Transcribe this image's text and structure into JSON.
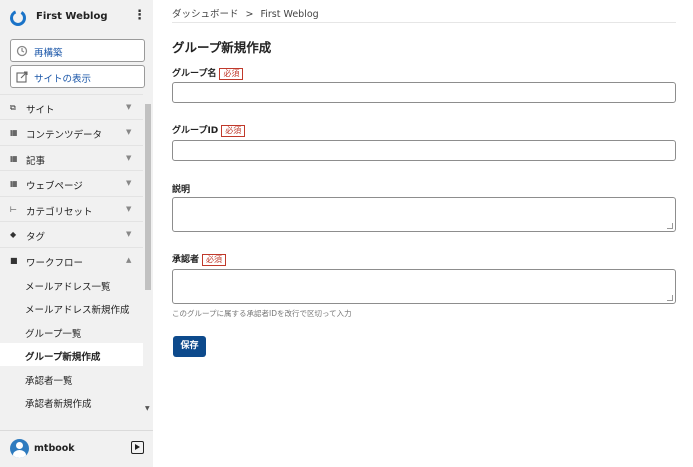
{
  "sidebar": {
    "site_title": "First Weblog",
    "kebab": "⋮",
    "buttons": [
      {
        "label": "再構築",
        "icon": "rebuild-icon"
      },
      {
        "label": "サイトの表示",
        "icon": "external-view-icon"
      }
    ],
    "menu": [
      {
        "label": "サイト",
        "icon": "site-icon",
        "chevron": "▼"
      },
      {
        "label": "コンテンツデータ",
        "icon": "content-data-icon",
        "chevron": "▼"
      },
      {
        "label": "記事",
        "icon": "entry-icon",
        "chevron": "▼"
      },
      {
        "label": "ウェブページ",
        "icon": "webpage-icon",
        "chevron": "▼"
      },
      {
        "label": "カテゴリセット",
        "icon": "category-set-icon",
        "chevron": "▼"
      },
      {
        "label": "タグ",
        "icon": "tag-icon",
        "chevron": "▼"
      },
      {
        "label": "ワークフロー",
        "icon": "workflow-icon",
        "chevron": "▲"
      }
    ],
    "submenu": [
      {
        "label": "メールアドレス一覧"
      },
      {
        "label": "メールアドレス新規作成"
      },
      {
        "label": "グループ一覧"
      },
      {
        "label": "グループ新規作成",
        "active": true
      },
      {
        "label": "承認者一覧"
      },
      {
        "label": "承認者新規作成"
      }
    ],
    "user": {
      "name": "mtbook"
    }
  },
  "breadcrumb": {
    "home": "ダッシュボード",
    "separator": ">",
    "current": "First Weblog"
  },
  "page": {
    "title": "グループ新規作成"
  },
  "form": {
    "group_name": {
      "label": "グループ名",
      "required": "必須",
      "value": ""
    },
    "group_id": {
      "label": "グループID",
      "required": "必須",
      "value": ""
    },
    "description": {
      "label": "説明",
      "value": ""
    },
    "approver": {
      "label": "承認者",
      "required": "必須",
      "value": "",
      "hint": "このグループに属する承認者IDを改行で区切って入力"
    },
    "save_label": "保存"
  },
  "colors": {
    "accent": "#0d4a8c",
    "link": "#1a56a8",
    "required": "#c0392b",
    "logo": "#1a73c8"
  }
}
